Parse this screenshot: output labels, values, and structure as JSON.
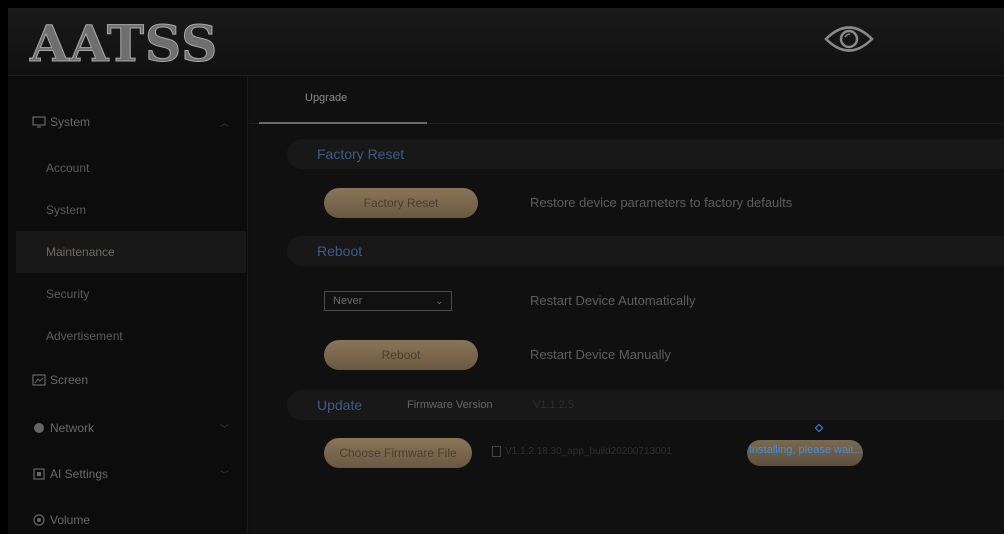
{
  "header": {
    "logo_text": "AATSS",
    "eye_icon": "eye-icon"
  },
  "sidebar": {
    "groups": [
      {
        "label": "System",
        "icon": "monitor-icon",
        "expanded": true
      },
      {
        "label": "Screen",
        "icon": "screen-icon"
      },
      {
        "label": "Network",
        "icon": "network-icon"
      },
      {
        "label": "AI Settings",
        "icon": "ai-icon"
      },
      {
        "label": "Volume",
        "icon": "volume-icon"
      }
    ],
    "system_items": [
      "Account",
      "System",
      "Maintenance",
      "Security",
      "Advertisement"
    ],
    "active_item": "Maintenance"
  },
  "main": {
    "tab": "Upgrade",
    "factory_reset": {
      "title": "Factory Reset",
      "button": "Factory Reset",
      "description": "Restore device parameters to factory defaults"
    },
    "reboot": {
      "title": "Reboot",
      "auto_select_value": "Never",
      "auto_description": "Restart Device Automatically",
      "button": "Reboot",
      "manual_description": "Restart Device Manually"
    },
    "update": {
      "title": "Update",
      "firmware_label": "Firmware Version",
      "firmware_value": "V1.1.2.5",
      "choose_button": "Choose Firmware File",
      "file_name": "V1.1.2.18.30_app_build20200713001",
      "status": "Installing, please wait..."
    }
  },
  "colors": {
    "accent_gold": "#8a7558",
    "section_title_blue": "#3c5c86",
    "status_blue": "#3f8fe0"
  }
}
